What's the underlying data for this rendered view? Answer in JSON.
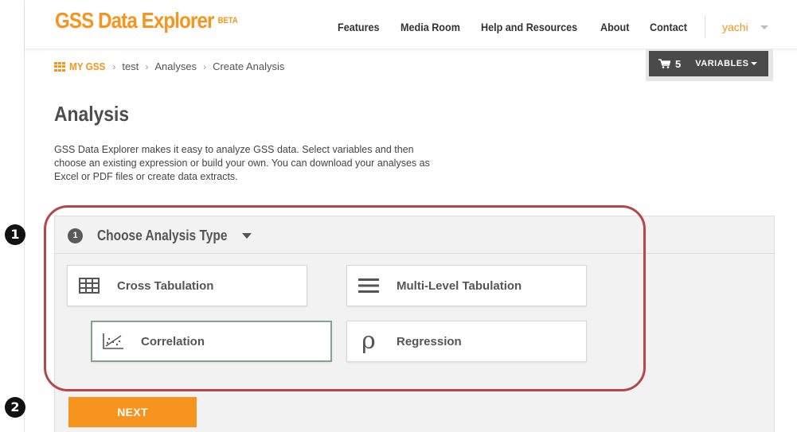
{
  "header": {
    "logo_text": "GSS Data Explorer",
    "logo_badge": "BETA",
    "nav": [
      {
        "label": "Features"
      },
      {
        "label": "Media Room"
      },
      {
        "label": "Help and Resources"
      },
      {
        "label": "About"
      },
      {
        "label": "Contact"
      }
    ],
    "user_name": "yachi"
  },
  "breadcrumb": {
    "items": [
      "MY GSS",
      "test",
      "Analyses",
      "Create Analysis"
    ]
  },
  "cart": {
    "count": "5",
    "label": "VARIABLES"
  },
  "page": {
    "title": "Analysis",
    "description": "GSS Data Explorer makes it easy to analyze GSS data. Select variables and then choose an existing expression or build your own. You can download your analyses as Excel or PDF files or create data extracts."
  },
  "panel": {
    "step_number": "1",
    "title": "Choose Analysis Type",
    "options": [
      {
        "label": "Cross Tabulation",
        "icon": "table-icon",
        "selected": false
      },
      {
        "label": "Multi-Level Tabulation",
        "icon": "menu-lines-icon",
        "selected": false
      },
      {
        "label": "Correlation",
        "icon": "scatter-plot-icon",
        "selected": true
      },
      {
        "label": "Regression",
        "icon": "rho-icon",
        "selected": false
      }
    ],
    "next_label": "NEXT"
  },
  "annotations": {
    "marker_1": "❶",
    "marker_2": "❷",
    "highlight_color": "#b5474a"
  },
  "colors": {
    "brand_orange": "#f7941d",
    "selected_border": "#7fa591",
    "cart_bg": "#4a4a4a"
  }
}
